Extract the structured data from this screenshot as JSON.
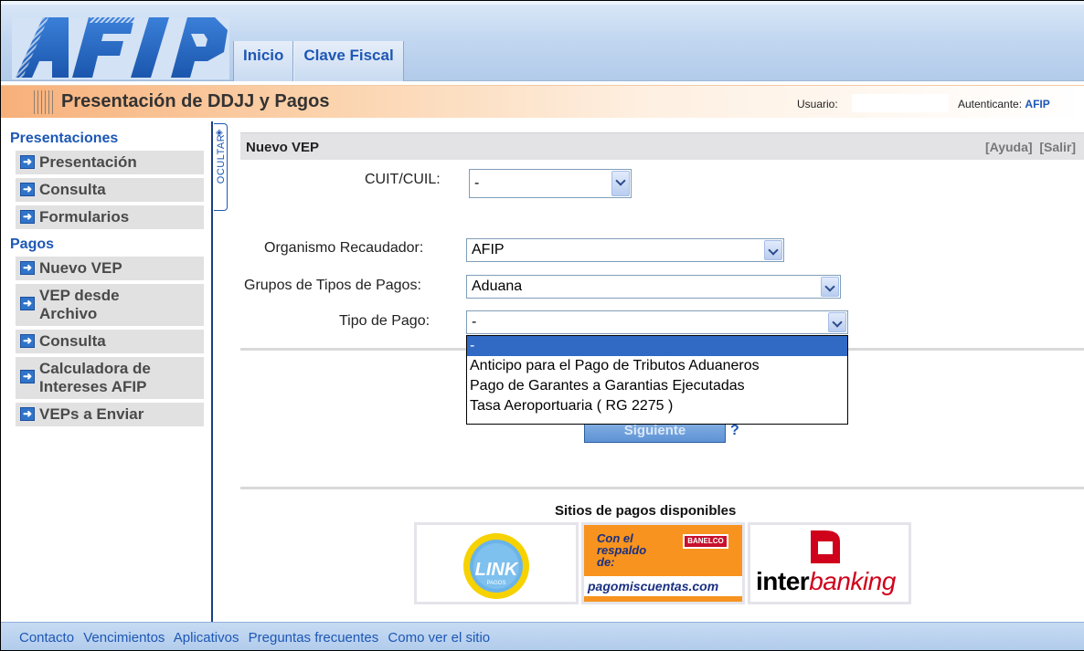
{
  "header": {
    "nav": [
      "Inicio",
      "Clave Fiscal"
    ]
  },
  "titlebar": {
    "title": "Presentación de DDJJ y Pagos",
    "user_label": "Usuario:",
    "auth_label": "Autenticante:",
    "auth_value": "AFIP"
  },
  "sidebar": {
    "section_presentaciones": "Presentaciones",
    "presentaciones": [
      "Presentación",
      "Consulta",
      "Formularios"
    ],
    "section_pagos": "Pagos",
    "pagos": [
      "Nuevo VEP",
      "VEP desde Archivo",
      "Consulta",
      "Calculadora de Intereses AFIP",
      "VEPs a Enviar"
    ],
    "toggle_label": "OCULTAR"
  },
  "vep": {
    "title": "Nuevo VEP",
    "help": "[Ayuda]",
    "exit": "[Salir]",
    "cuit_label": "CUIT/CUIL:",
    "cuit_value": "-",
    "organismo_label": "Organismo Recaudador:",
    "organismo_value": "AFIP",
    "grupos_label": "Grupos de Tipos de Pagos:",
    "grupos_value": "Aduana",
    "tipo_label": "Tipo de Pago:",
    "tipo_value": "-",
    "tipo_options": [
      "-",
      "Anticipo para el Pago de Tributos Aduaneros",
      "Pago de Garantes a Garantias Ejecutadas",
      "Tasa Aeroportuaria ( RG 2275 )"
    ],
    "next_button": "Siguiente",
    "help_icon": "?"
  },
  "sitios": {
    "title": "Sitios de pagos disponibles",
    "link_text": "LINK",
    "link_sub": "PAGOS",
    "pmc_top": "Con el respaldo de:",
    "pmc_badge": "BANELCO",
    "pmc_brand": "pagomiscuentas.com",
    "interbanking_a": "inter",
    "interbanking_b": "banking"
  },
  "footer": {
    "links": [
      "Contacto",
      "Vencimientos",
      "Aplicativos",
      "Preguntas frecuentes",
      "Como ver el sitio"
    ]
  },
  "colors": {
    "accent": "#1d57b5",
    "selection": "#316ac5",
    "title_gradient_start": "#f7b07a",
    "sidebar_item_bg": "#e1e1e1"
  }
}
